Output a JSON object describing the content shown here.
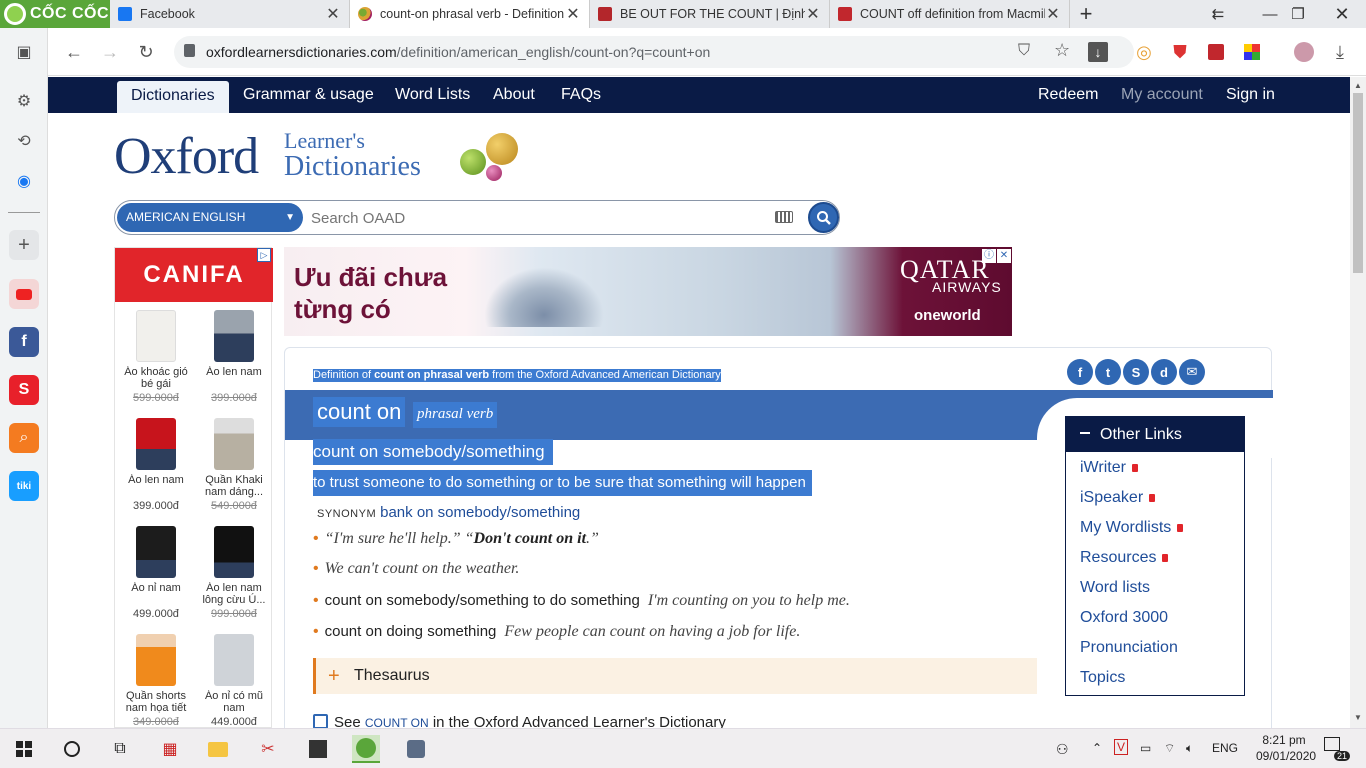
{
  "browser": {
    "brand": "CỐC CỐC",
    "tabs": [
      {
        "title": "Facebook",
        "active": false
      },
      {
        "title": "count-on phrasal verb - Definition",
        "active": true
      },
      {
        "title": "BE OUT FOR THE COUNT | Định ng",
        "active": false
      },
      {
        "title": "COUNT off definition from Macmil",
        "active": false
      }
    ],
    "url_host": "oxfordlearnersdictionaries.com",
    "url_path": "/definition/american_english/count-on?q=count+on"
  },
  "site": {
    "nav_left": [
      "Dictionaries",
      "Grammar & usage",
      "Word Lists",
      "About",
      "FAQs"
    ],
    "nav_right": [
      "Redeem",
      "My account",
      "Sign in"
    ],
    "logo_main": "Oxford",
    "logo_sub1": "Learner's",
    "logo_sub2": "Dictionaries",
    "dict_select": "AMERICAN ENGLISH",
    "search_placeholder": "Search OAAD"
  },
  "left_ad": {
    "brand": "CANIFA",
    "items": [
      {
        "name": "Áo khoác gió bé gái",
        "price": "599.000đ",
        "old": true
      },
      {
        "name": "Áo len nam",
        "price": "399.000đ",
        "old": true
      },
      {
        "name": "Áo len nam",
        "price": "399.000đ",
        "old": false
      },
      {
        "name": "Quần Khaki nam dáng...",
        "price": "549.000đ",
        "old": true
      },
      {
        "name": "Áo nỉ nam",
        "price": "499.000đ",
        "old": false
      },
      {
        "name": "Áo len nam lông cừu Ú...",
        "price": "999.000đ",
        "old": true
      },
      {
        "name": "Quần shorts nam họa tiết",
        "price": "349.000đ",
        "old": true
      },
      {
        "name": "Áo nỉ có mũ nam",
        "price": "449.000đ",
        "old": false
      }
    ]
  },
  "banner": {
    "headline1": "Ưu đãi chưa",
    "headline2": "từng có",
    "brand1": "QATAR",
    "brand2": "AIRWAYS",
    "brand3": "oneworld"
  },
  "entry": {
    "def_prefix": "Definition of ",
    "def_bold": "count on phrasal verb",
    "def_suffix": " from the Oxford Advanced American Dictionary",
    "headword": "count on",
    "pos": "phrasal verb",
    "idiom": "count on somebody/something",
    "definition": "to trust someone to do something or to be sure that something will happen",
    "synonym_label": "SYNONYM",
    "synonym": "bank on somebody/something",
    "ex1_a": "“I'm sure he'll help.” “",
    "ex1_b": "Don't count on it",
    "ex1_c": ".”",
    "ex2": "We can't count on the weather.",
    "ex3_cf": "count on somebody/something to do something",
    "ex3": "I'm counting on you to help me.",
    "ex4_cf": "count on doing something",
    "ex4": "Few people can count on having a job for life.",
    "thesaurus": "Thesaurus",
    "see_a": "See",
    "see_sc": "COUNT ON",
    "see_b": "in the Oxford Advanced Learner's Dictionary"
  },
  "other_links": {
    "title": "Other Links",
    "items": [
      {
        "label": "iWriter",
        "locked": true
      },
      {
        "label": "iSpeaker",
        "locked": true
      },
      {
        "label": "My Wordlists",
        "locked": true
      },
      {
        "label": "Resources",
        "locked": true
      },
      {
        "label": "Word lists",
        "locked": false
      },
      {
        "label": "Oxford 3000",
        "locked": false
      },
      {
        "label": "Pronunciation",
        "locked": false
      },
      {
        "label": "Topics",
        "locked": false
      }
    ]
  },
  "taskbar": {
    "lang": "ENG",
    "time": "8:21 pm",
    "date": "09/01/2020",
    "notif": "21"
  },
  "colors": {
    "nav": "#0a1b46",
    "accent": "#2f67b3",
    "selection": "#3c7bd1",
    "orange": "#e07a1f"
  }
}
